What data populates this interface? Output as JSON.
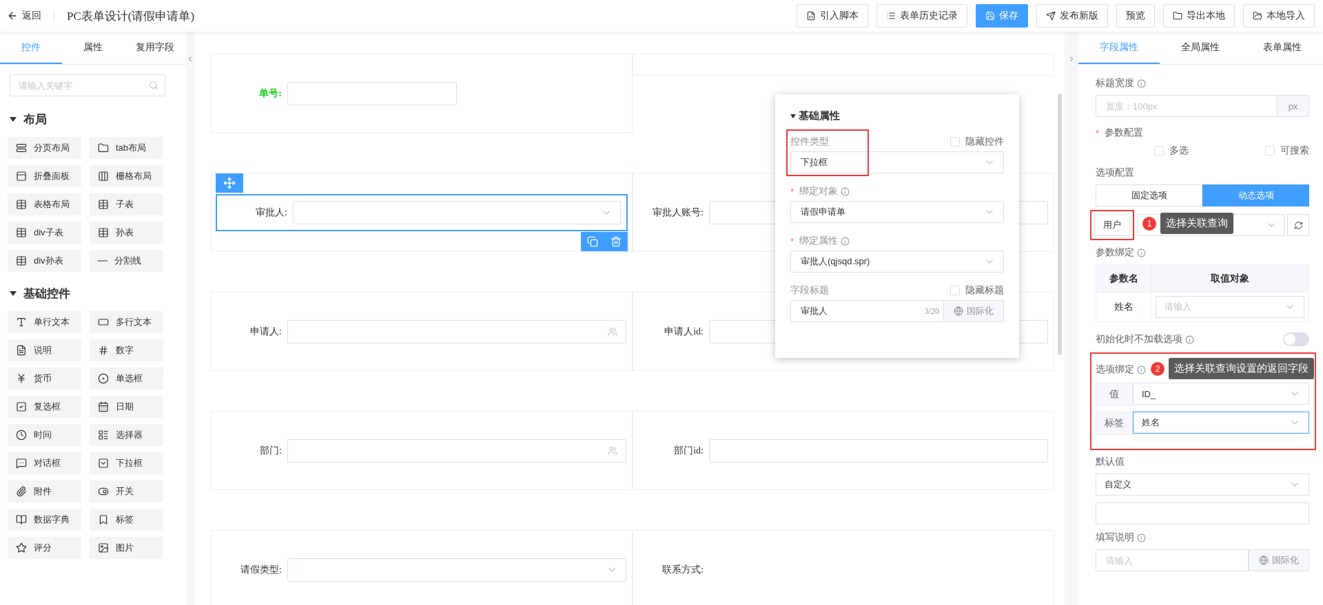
{
  "topbar": {
    "back": "返回",
    "title": "PC表单设计(请假申请单)",
    "buttons": [
      {
        "label": "引入脚本",
        "primary": false
      },
      {
        "label": "表单历史记录",
        "primary": false
      },
      {
        "label": "保存",
        "primary": true
      },
      {
        "label": "发布新版",
        "primary": false
      },
      {
        "label": "预览",
        "primary": false
      },
      {
        "label": "导出本地",
        "primary": false
      },
      {
        "label": "本地导入",
        "primary": false
      }
    ]
  },
  "left_panel": {
    "tabs": [
      {
        "label": "控件",
        "selected": true
      },
      {
        "label": "属性",
        "selected": false
      },
      {
        "label": "复用字段",
        "selected": false
      }
    ],
    "search": {
      "placeholder": "请输入关键字"
    },
    "groups": [
      {
        "title": "布局",
        "expanded": true,
        "items": [
          {
            "label": "分页布局"
          },
          {
            "label": "tab布局"
          },
          {
            "label": "折叠面板"
          },
          {
            "label": "栅格布局"
          },
          {
            "label": "表格布局"
          },
          {
            "label": "子表"
          },
          {
            "label": "div子表"
          },
          {
            "label": "孙表"
          },
          {
            "label": "div孙表"
          },
          {
            "label": "分割线"
          }
        ]
      },
      {
        "title": "基础控件",
        "expanded": true,
        "items": [
          {
            "label": "单行文本"
          },
          {
            "label": "多行文本"
          },
          {
            "label": "说明"
          },
          {
            "label": "数字"
          },
          {
            "label": "货币"
          },
          {
            "label": "单选框"
          },
          {
            "label": "复选框"
          },
          {
            "label": "日期"
          },
          {
            "label": "时间"
          },
          {
            "label": "选择器"
          },
          {
            "label": "对话框"
          },
          {
            "label": "下拉框"
          },
          {
            "label": "附件"
          },
          {
            "label": "开关"
          },
          {
            "label": "数据字典"
          },
          {
            "label": "标签"
          },
          {
            "label": "评分"
          },
          {
            "label": "图片"
          }
        ]
      }
    ]
  },
  "canvas": {
    "rows": [
      {
        "cells": [
          {
            "label": "单号:",
            "kind": "short",
            "color": "#1fd11f",
            "selected": false
          },
          {
            "kind": "blank",
            "selected": false
          }
        ]
      },
      {
        "cells": [
          {
            "label": "审批人:",
            "kind": "select",
            "selected": true
          },
          {
            "label": "审批人账号:",
            "kind": "text",
            "selected": false
          }
        ]
      },
      {
        "cells": [
          {
            "label": "申请人:",
            "kind": "picker",
            "selected": false
          },
          {
            "label": "申请人id:",
            "kind": "text",
            "selected": false
          }
        ]
      },
      {
        "cells": [
          {
            "label": "部门:",
            "kind": "picker",
            "selected": false
          },
          {
            "label": "部门id:",
            "kind": "text",
            "selected": false
          }
        ]
      },
      {
        "cells": [
          {
            "label": "请假类型:",
            "kind": "select",
            "selected": false
          },
          {
            "label": "联系方式:",
            "kind": "none",
            "selected": false
          }
        ]
      }
    ]
  },
  "popup": {
    "title": "基础属性",
    "expanded": true,
    "fields": [
      {
        "label": "控件类型",
        "info": false,
        "value": "下拉框",
        "outlined": true,
        "checkbox": {
          "label": "隐藏控件",
          "checked": false
        }
      },
      {
        "required_mark": "*",
        "label": "绑定对象",
        "info": true,
        "value": "请假申请单",
        "outlined": false
      },
      {
        "required_mark": "*",
        "label": "绑定属性",
        "info": true,
        "value": "审批人(qjsqd.spr)",
        "outlined": false
      },
      {
        "label": "字段标题",
        "info": false,
        "value": "审批人",
        "counter": "3/20",
        "addon": "国际化",
        "outlined": false,
        "checkbox": {
          "label": "隐藏标题",
          "checked": false
        }
      }
    ]
  },
  "right_panel": {
    "tabs": [
      {
        "label": "字段属性",
        "selected": true
      },
      {
        "label": "全局属性",
        "selected": false
      },
      {
        "label": "表单属性",
        "selected": false
      }
    ],
    "title_width": {
      "label": "标题宽度",
      "placeholder": "宽度：100px",
      "unit": "px"
    },
    "params": {
      "required_mark": "*",
      "label": "参数配置",
      "options": [
        {
          "label": "多选",
          "checked": false
        },
        {
          "label": "可搜索",
          "checked": false
        }
      ]
    },
    "option_config": {
      "label": "选项配置",
      "segments": [
        {
          "label": "固定选项",
          "selected": false
        },
        {
          "label": "动态选项",
          "selected": true
        }
      ]
    },
    "query": {
      "tag": "用户",
      "outlined": true,
      "hint": {
        "number": "1",
        "text": "选择关联查询"
      }
    },
    "param_binding": {
      "label": "参数绑定",
      "columns": [
        "参数名",
        "取值对象"
      ],
      "rows": [
        {
          "name": "姓名",
          "placeholder": "请输入"
        }
      ]
    },
    "no_load": {
      "label": "初始化时不加载选项",
      "on": false
    },
    "option_binding": {
      "label": "选项绑定",
      "outlined": true,
      "hint": {
        "number": "2",
        "text": "选择关联查询设置的返回字段"
      },
      "rows": [
        {
          "label": "值",
          "value": "ID_",
          "focused": false
        },
        {
          "label": "标签",
          "value": "姓名",
          "focused": true
        }
      ]
    },
    "default_value": {
      "label": "默认值",
      "value": "自定义"
    },
    "fill_note": {
      "label": "填写说明",
      "placeholder": "请输入",
      "addon": "国际化"
    }
  }
}
